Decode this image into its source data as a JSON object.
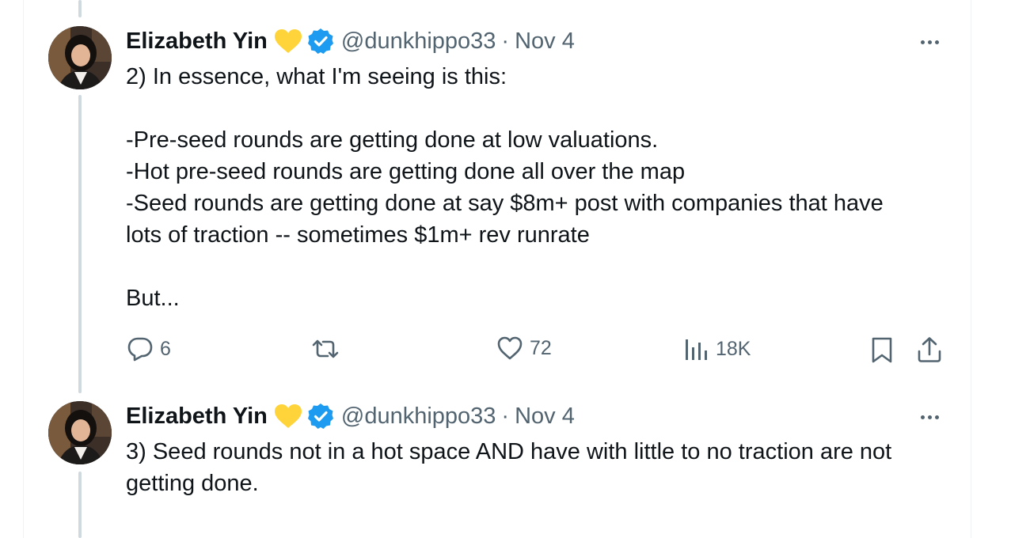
{
  "tweets": [
    {
      "author": {
        "name": "Elizabeth Yin",
        "handle": "@dunkhippo33"
      },
      "date": "Nov 4",
      "separator": "·",
      "lines": [
        "2) In essence, what I'm seeing is this:",
        "",
        "-Pre-seed rounds are getting done at low valuations.",
        "-Hot pre-seed rounds are getting done all over the map",
        "-Seed rounds are getting done at say $8m+ post with companies that have",
        "lots of traction -- sometimes $1m+ rev runrate",
        "",
        "But..."
      ],
      "stats": {
        "replies": "6",
        "likes": "72",
        "views": "18K"
      }
    },
    {
      "author": {
        "name": "Elizabeth Yin",
        "handle": "@dunkhippo33"
      },
      "date": "Nov 4",
      "separator": "·",
      "lines": [
        "3) Seed rounds not in a hot space AND have with little to no traction are not",
        "getting done."
      ]
    }
  ],
  "colors": {
    "text": "#0f1419",
    "secondary": "#536471",
    "verified": "#1d9bf0",
    "heart": "#ffd43b",
    "thread_line": "#cfd9de"
  },
  "icons": [
    "yellow-heart-icon",
    "verified-badge-icon",
    "more-icon",
    "reply-icon",
    "retweet-icon",
    "like-icon",
    "views-icon",
    "bookmark-icon",
    "share-icon"
  ]
}
